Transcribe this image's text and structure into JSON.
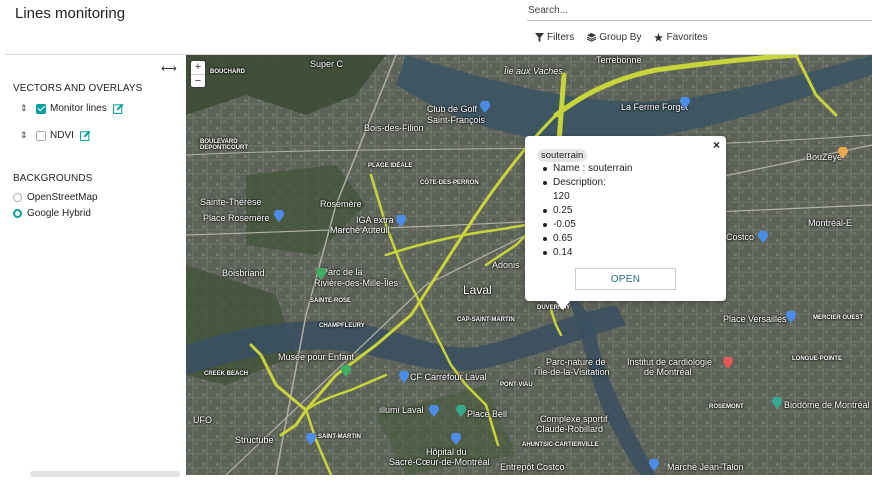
{
  "app": {
    "title": "Lines monitoring"
  },
  "search": {
    "placeholder": "Search..."
  },
  "filters": {
    "filters_label": "Filters",
    "groupby_label": "Group By",
    "favorites_label": "Favorites"
  },
  "sidebar": {
    "vectors_title": "VECTORS AND OVERLAYS",
    "layers": [
      {
        "label": "Monitor lines",
        "checked": true
      },
      {
        "label": "NDVI",
        "checked": false
      }
    ],
    "backgrounds_title": "BACKGROUNDS",
    "backgrounds": [
      {
        "label": "OpenStreetMap",
        "selected": false
      },
      {
        "label": "Google Hybrid",
        "selected": true
      }
    ]
  },
  "map": {
    "zoom_in": "+",
    "zoom_out": "−",
    "line_color": "#c8d43a",
    "labels": {
      "super_c": "Super C",
      "ile_aux_vaches": "Île aux Vaches",
      "terrebonne": "Terrebonne",
      "bouchard": "BOUCHARD",
      "club_golf": "Club de Golf",
      "saint_francois": "Saint-François",
      "bois_des_filion": "Bois-des-Filion",
      "la_ferme_forget": "La Ferme Forget",
      "blvd_deponticourt": "BOULEVARD\nDEPONTICOURT",
      "plage_ideale": "PLAGE IDÉALE",
      "cote_des_perron": "CÔTE-DES-PERRON",
      "bouzeye": "BouZeye",
      "saint_therese": "Sainte-Thérèse",
      "place_rosemere": "Place Rosemère",
      "rosemere": "Rosemère",
      "iga_extra": "IGA extra",
      "marche_auteuil": "Marché Auteuil",
      "costco": "Costco",
      "montreal_e": "Montréal-E",
      "boisbriand": "Boisbriand",
      "parc_riviere_1": "Parc de la",
      "parc_riviere_2": "Rivière-des-Mille-Îles",
      "adonis": "Adonis",
      "laval": "Laval",
      "sainte_rose": "SAINTE-ROSE",
      "champfleury": "CHAMPFLEURY",
      "cap_saint_martin": "CAP-SAINT-MARTIN",
      "place_versailles": "Place Versailles",
      "musee_enfant": "Musée pour Enfant",
      "cf_carrefour": "CF Carrefour Laval",
      "parc_nature_1": "Parc-nature de",
      "parc_nature_2": "l'Île-de-la-Visitation",
      "institut_1": "Institut de cardiologie",
      "institut_2": "de Montréal",
      "creek_beach": "CREEK BEACH",
      "pont_viau": "PONT-VIAU",
      "complexe_1": "Complexe sportif",
      "complexe_2": "Claude-Robillard",
      "biodome": "Biodôme de Montréal",
      "illumi": "illumi Laval",
      "place_bell": "Place Bell",
      "structube": "Structube",
      "ahuntsic": "AHUNTSIC-CARTIERVILLE",
      "saint_martin": "SAINT-MARTIN",
      "hopital_1": "Hôpital du",
      "hopital_2": "Sacré-Cœur-de-Montréal",
      "entrepot_costco": "Entrepôt Costco",
      "marche_jean_talon": "Marché Jean-Talon",
      "longue_pointe": "LONGUE-POINTE",
      "rosemont": "ROSEMONT",
      "mercier_ouest": "MERCIER OUEST",
      "ufo": "UFO",
      "duvernay": "DUVERNAY"
    }
  },
  "popup": {
    "tag": "souterrain",
    "close": "×",
    "items": [
      "Name : souterrain",
      "Description:",
      "120",
      "0.25",
      "-0.05",
      "0.65",
      "0.14"
    ],
    "open_label": "OPEN"
  }
}
